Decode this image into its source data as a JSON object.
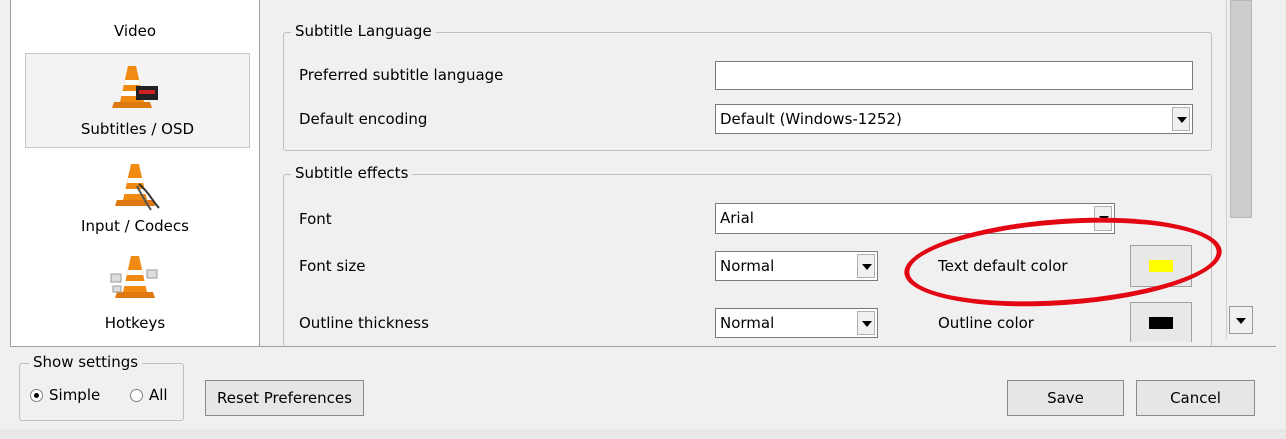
{
  "sidebar": {
    "items": [
      {
        "label": "Video",
        "icon": "vlc-video-cone-icon"
      },
      {
        "label": "Subtitles / OSD",
        "icon": "vlc-subtitles-cone-icon",
        "selected": true
      },
      {
        "label": "Input / Codecs",
        "icon": "vlc-input-codecs-cone-icon"
      },
      {
        "label": "Hotkeys",
        "icon": "vlc-hotkeys-cone-icon"
      }
    ]
  },
  "subtitle_language": {
    "title": "Subtitle Language",
    "preferred_label": "Preferred subtitle language",
    "preferred_value": "",
    "encoding_label": "Default encoding",
    "encoding_value": "Default (Windows-1252)"
  },
  "subtitle_effects": {
    "title": "Subtitle effects",
    "font_label": "Font",
    "font_value": "Arial",
    "font_size_label": "Font size",
    "font_size_value": "Normal",
    "text_color_label": "Text default color",
    "text_color": "#ffff00",
    "outline_thickness_label": "Outline thickness",
    "outline_thickness_value": "Normal",
    "outline_color_label": "Outline color",
    "outline_color": "#000000"
  },
  "show_settings": {
    "title": "Show settings",
    "simple_label": "Simple",
    "all_label": "All",
    "selected": "Simple"
  },
  "buttons": {
    "reset": "Reset Preferences",
    "save": "Save",
    "cancel": "Cancel"
  },
  "colors": {
    "highlight_annotation": "#e30613"
  }
}
